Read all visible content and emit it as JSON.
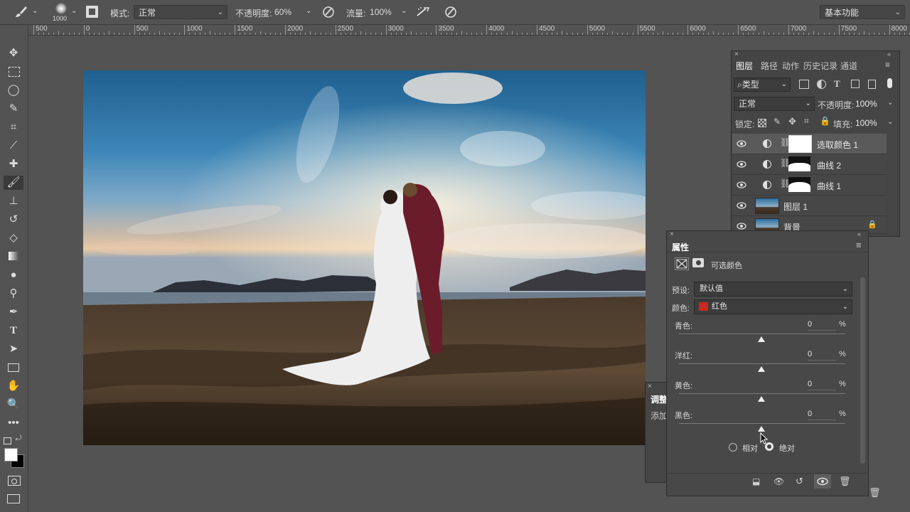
{
  "options_bar": {
    "brush_size": "1000",
    "mode_label": "模式:",
    "mode_value": "正常",
    "opacity_label": "不透明度:",
    "opacity_value": "60%",
    "flow_label": "流量:",
    "flow_value": "100%",
    "workspace": "基本功能"
  },
  "ruler": {
    "labels": [
      "500",
      "0",
      "500",
      "1000",
      "1500",
      "2000",
      "2500",
      "3000",
      "3500",
      "4000",
      "4500",
      "5000",
      "5500",
      "6000",
      "6500",
      "7000",
      "7500",
      "8000"
    ]
  },
  "layers_panel": {
    "tabs": [
      "图层",
      "路径",
      "动作",
      "历史记录",
      "通道"
    ],
    "filter_type": "类型",
    "blend_mode": "正常",
    "opacity_label": "不透明度:",
    "opacity_value": "100%",
    "lock_label": "锁定:",
    "fill_label": "填充:",
    "fill_value": "100%",
    "layers": [
      {
        "name": "选取颜色 1"
      },
      {
        "name": "曲线 2"
      },
      {
        "name": "曲线 1"
      },
      {
        "name": "图层 1"
      },
      {
        "name": "背景"
      }
    ]
  },
  "adjust_panel": {
    "title": "调整",
    "add_text": "添加"
  },
  "properties_panel": {
    "title": "属性",
    "adjustment_name": "可选颜色",
    "preset_label": "预设:",
    "preset_value": "默认值",
    "colors_label": "颜色:",
    "colors_value": "红色",
    "colors_swatch": "#c8281e",
    "sliders": [
      {
        "label": "青色:",
        "value": "0",
        "unit": "%"
      },
      {
        "label": "洋红:",
        "value": "0",
        "unit": "%"
      },
      {
        "label": "黄色:",
        "value": "0",
        "unit": "%"
      },
      {
        "label": "黑色:",
        "value": "0",
        "unit": "%"
      }
    ],
    "method_relative": "相对",
    "method_absolute": "绝对",
    "method_selected": "absolute"
  }
}
